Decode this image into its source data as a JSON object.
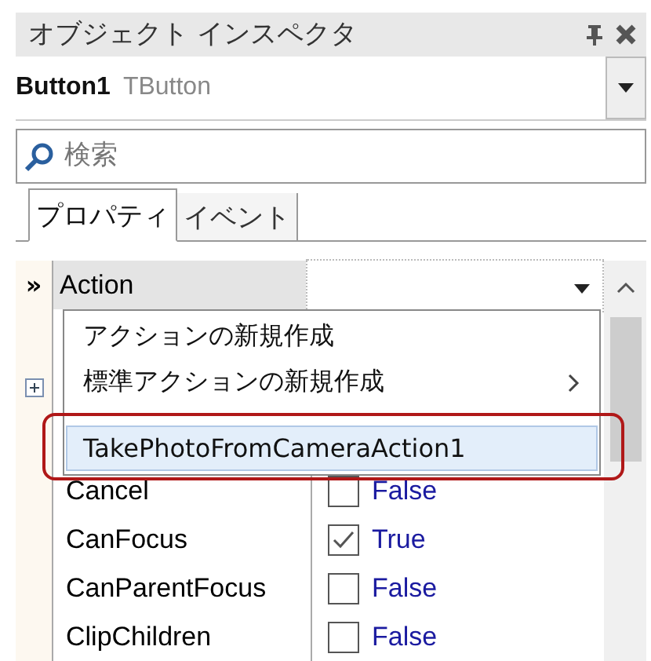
{
  "panel": {
    "title": "オブジェクト インスペクタ"
  },
  "object": {
    "name": "Button1",
    "type": "TButton"
  },
  "search": {
    "placeholder": "検索"
  },
  "tabs": [
    {
      "label": "プロパティ",
      "selected": true
    },
    {
      "label": "イベント",
      "selected": false
    }
  ],
  "gutter_mark": "»",
  "active_property": {
    "name": "Action"
  },
  "dropdown_menu": [
    {
      "kind": "item",
      "label": "アクションの新規作成",
      "selected": false,
      "outlined": false
    },
    {
      "kind": "submenu",
      "label": "標準アクションの新規作成",
      "selected": false,
      "outlined": false
    },
    {
      "kind": "separator"
    },
    {
      "kind": "item",
      "label": "TakePhotoFromCameraAction1",
      "selected": true,
      "outlined": true
    }
  ],
  "rows": [
    {
      "name": "Cancel",
      "value": "False",
      "checked": false
    },
    {
      "name": "CanFocus",
      "value": "True",
      "checked": true
    },
    {
      "name": "CanParentFocus",
      "value": "False",
      "checked": false
    },
    {
      "name": "ClipChildren",
      "value": "False",
      "checked": false
    }
  ]
}
